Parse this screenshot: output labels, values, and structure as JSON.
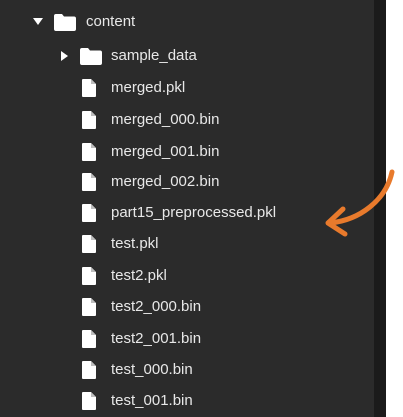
{
  "tree": {
    "root": {
      "label": "content",
      "expanded": true
    },
    "items": [
      {
        "label": "sample_data",
        "type": "folder",
        "expanded": false
      },
      {
        "label": "merged.pkl",
        "type": "file"
      },
      {
        "label": "merged_000.bin",
        "type": "file"
      },
      {
        "label": "merged_001.bin",
        "type": "file"
      },
      {
        "label": "merged_002.bin",
        "type": "file"
      },
      {
        "label": "part15_preprocessed.pkl",
        "type": "file"
      },
      {
        "label": "test.pkl",
        "type": "file"
      },
      {
        "label": "test2.pkl",
        "type": "file"
      },
      {
        "label": "test2_000.bin",
        "type": "file"
      },
      {
        "label": "test2_001.bin",
        "type": "file"
      },
      {
        "label": "test_000.bin",
        "type": "file"
      },
      {
        "label": "test_001.bin",
        "type": "file"
      }
    ]
  },
  "colors": {
    "panel_bg": "#2b2b2b",
    "text": "#e8e8e8",
    "icon": "#ffffff",
    "annotation_arrow": "#e87a2c"
  }
}
